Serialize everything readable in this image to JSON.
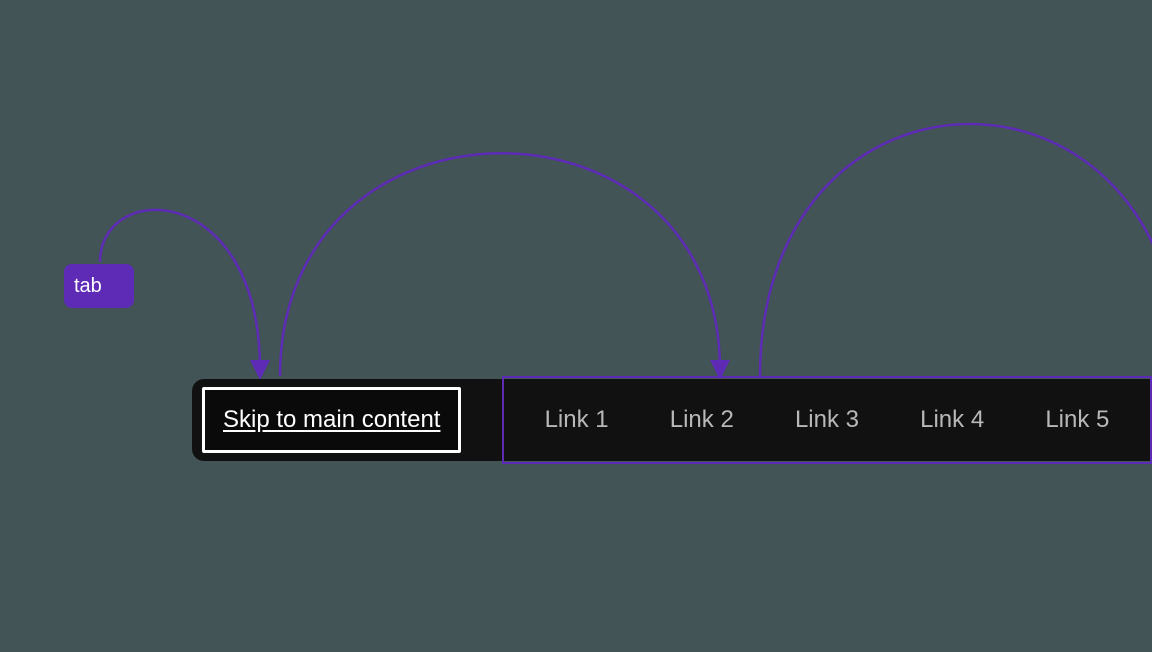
{
  "tab_key": {
    "label": "tab"
  },
  "skip_link": {
    "label": "Skip to main content"
  },
  "nav": {
    "links": [
      "Link 1",
      "Link 2",
      "Link 3",
      "Link 4",
      "Link 5"
    ]
  },
  "colors": {
    "accent": "#5d2bb6",
    "canvas": "#435457",
    "bar": "#111111",
    "outline": "#ffffff",
    "link": "#b8b8b8"
  }
}
